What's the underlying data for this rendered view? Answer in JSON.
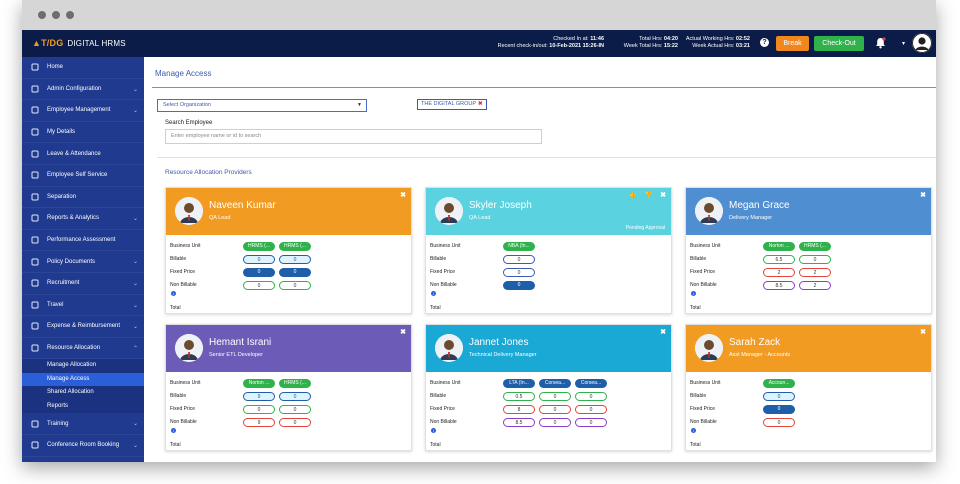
{
  "topbar": {
    "logo_mark": "▲T/DG",
    "app_name": "DIGITAL HRMS",
    "checked_in_label": "Checked In at:",
    "checked_in_value": "11:46",
    "recent_label": "Recent check-in/out:",
    "recent_value": "10-Feb-2021 15:26-IN",
    "total_hrs_label": "Total Hrs:",
    "total_hrs_value": "04:20",
    "week_total_label": "Week Total Hrs:",
    "week_total_value": "15:22",
    "actual_working_label": "Actual Working Hrs:",
    "actual_working_value": "02:52",
    "week_actual_label": "Week Actual Hrs:",
    "week_actual_value": "03:21",
    "help": "?",
    "break_label": "Break",
    "checkout_label": "Check-Out",
    "user_caret": "▾"
  },
  "sidebar": {
    "items": [
      {
        "label": "Home",
        "chev": ""
      },
      {
        "label": "Admin Configuration",
        "chev": "⌄"
      },
      {
        "label": "Employee Management",
        "chev": "⌄"
      },
      {
        "label": "My Details",
        "chev": ""
      },
      {
        "label": "Leave & Attendance",
        "chev": ""
      },
      {
        "label": "Employee Self Service",
        "chev": ""
      },
      {
        "label": "Separation",
        "chev": ""
      },
      {
        "label": "Reports & Analytics",
        "chev": "⌄"
      },
      {
        "label": "Performance Assessment",
        "chev": ""
      },
      {
        "label": "Policy Documents",
        "chev": "⌄"
      },
      {
        "label": "Recruitment",
        "chev": "⌄"
      },
      {
        "label": "Travel",
        "chev": "⌄"
      },
      {
        "label": "Expense & Reimbursement",
        "chev": "⌄"
      },
      {
        "label": "Resource Allocation",
        "chev": "⌃"
      }
    ],
    "subitems": [
      "Manage Allocation",
      "Manage Access",
      "Shared Allocation",
      "Reports"
    ],
    "bottom_items": [
      {
        "label": "Training",
        "chev": "⌄"
      },
      {
        "label": "Conference Room Booking",
        "chev": "⌄"
      }
    ]
  },
  "main": {
    "title": "Manage Access",
    "org_placeholder": "Select Organization",
    "tag_label": "THE DIGITAL GROUP",
    "tag_close": "✖",
    "search_label": "Search Employee",
    "search_placeholder": "Enter employee name or id to search",
    "section_title": "Resource Allocation Providers"
  },
  "card_labels": {
    "business_unit": "Business Unit",
    "billable": "Billable",
    "fixed_price": "Fixed Price",
    "non_billable": "Non Billable",
    "total": "Total",
    "close": "✖",
    "pending": "Pending Approval",
    "actions": "👍 👎"
  },
  "cards": [
    {
      "name": "Naveen Kumar",
      "role": "QA Lead",
      "color": "#f29b22",
      "units": [
        "HRMS (...",
        "HRMS (..."
      ],
      "billable": [
        "0",
        "0"
      ],
      "fixed": [
        "0",
        "0"
      ],
      "nonbillable": [
        "0",
        "0"
      ]
    },
    {
      "name": "Skyler Joseph",
      "role": "QA Lead",
      "color": "#5ad2e0",
      "units": [
        "NBA (In..."
      ],
      "billable": [
        "0"
      ],
      "fixed": [
        "0"
      ],
      "nonbillable": [
        "0"
      ]
    },
    {
      "name": "Megan Grace",
      "role": "Delivery Manager",
      "color": "#4f8ed0",
      "units": [
        "Norton ...",
        "HRMS (..."
      ],
      "billable": [
        "6.5",
        "0"
      ],
      "fixed": [
        "2",
        "2"
      ],
      "nonbillable": [
        "8.5",
        "2"
      ]
    },
    {
      "name": "Hemant Israni",
      "role": "Senior ETL Developer",
      "color": "#6d5bb8",
      "units": [
        "Norton ...",
        "HRMS (..."
      ],
      "billable": [
        "9",
        "0"
      ],
      "fixed": [
        "0",
        "0"
      ],
      "nonbillable": [
        "9",
        "0"
      ]
    },
    {
      "name": "Jannet Jones",
      "role": "Technical Delivery Manager",
      "color": "#1aa8d4",
      "units": [
        "LTA (In...",
        "Corsea...",
        "Corsea..."
      ],
      "billable": [
        "0.5",
        "0",
        "0"
      ],
      "fixed": [
        "8",
        "0",
        "0"
      ],
      "nonbillable": [
        "8.5",
        "0",
        "0"
      ]
    },
    {
      "name": "Sarah Zack",
      "role": "Asst Manager - Accounts",
      "color": "#f29b22",
      "units": [
        "Accoun..."
      ],
      "billable": [
        "0"
      ],
      "fixed": [
        "0"
      ],
      "nonbillable": [
        "0"
      ]
    }
  ]
}
